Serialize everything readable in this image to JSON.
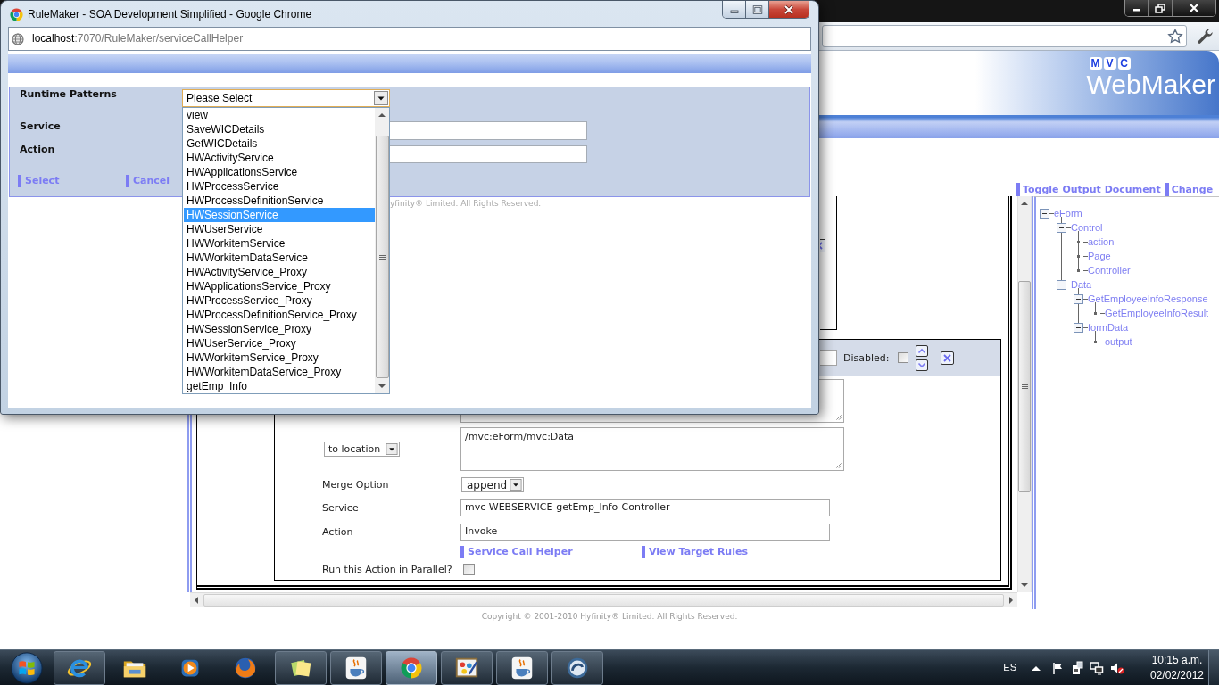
{
  "popup_window": {
    "title": "RuleMaker - SOA Development Simplified - Google Chrome",
    "address": {
      "host": "localhost",
      "path": ":7070/RuleMaker/serviceCallHelper"
    },
    "form": {
      "runtime_patterns": {
        "label": "Runtime Patterns",
        "value": "Please Select",
        "expanded": true,
        "options": [
          {
            "label": "view",
            "selected": false
          },
          {
            "label": "SaveWICDetails",
            "selected": false
          },
          {
            "label": "GetWICDetails",
            "selected": false
          },
          {
            "label": "HWActivityService",
            "selected": false
          },
          {
            "label": "HWApplicationsService",
            "selected": false
          },
          {
            "label": "HWProcessService",
            "selected": false
          },
          {
            "label": "HWProcessDefinitionService",
            "selected": false
          },
          {
            "label": "HWSessionService",
            "selected": true
          },
          {
            "label": "HWUserService",
            "selected": false
          },
          {
            "label": "HWWorkitemService",
            "selected": false
          },
          {
            "label": "HWWorkitemDataService",
            "selected": false
          },
          {
            "label": "HWActivityService_Proxy",
            "selected": false
          },
          {
            "label": "HWApplicationsService_Proxy",
            "selected": false
          },
          {
            "label": "HWProcessService_Proxy",
            "selected": false
          },
          {
            "label": "HWProcessDefinitionService_Proxy",
            "selected": false
          },
          {
            "label": "HWSessionService_Proxy",
            "selected": false
          },
          {
            "label": "HWUserService_Proxy",
            "selected": false
          },
          {
            "label": "HWWorkitemService_Proxy",
            "selected": false
          },
          {
            "label": "HWWorkitemDataService_Proxy",
            "selected": false
          },
          {
            "label": "getEmp_Info",
            "selected": false
          }
        ]
      },
      "service": {
        "label": "Service"
      },
      "action": {
        "label": "Action"
      },
      "links": [
        "Select",
        "Cancel"
      ]
    },
    "footer": "yfinity® Limited. All Rights Reserved."
  },
  "browser_page": {
    "logo": {
      "letters": [
        "M",
        "V",
        "C"
      ],
      "name": "WebMaker"
    },
    "output_links": [
      "Toggle Output Document",
      "Change"
    ],
    "rule_row": {
      "disabled": {
        "label": "Disabled:",
        "checked": false
      }
    },
    "action_form": {
      "location": {
        "option": "to location",
        "value": "/mvc:eForm/mvc:Data"
      },
      "merge_option": {
        "label": "Merge Option",
        "value": "append"
      },
      "service": {
        "label": "Service",
        "value": "mvc-WEBSERVICE-getEmp_Info-Controller"
      },
      "action": {
        "label": "Action",
        "value": "Invoke"
      },
      "links": [
        "Service Call Helper",
        "View Target Rules"
      ],
      "parallel": {
        "label": "Run this Action in Parallel?",
        "checked": false
      }
    },
    "output_tree": [
      {
        "label": "eForm",
        "expanded": true,
        "children": [
          {
            "label": "Control",
            "expanded": true,
            "children": [
              {
                "label": "action"
              },
              {
                "label": "Page"
              },
              {
                "label": "Controller"
              }
            ]
          },
          {
            "label": "Data",
            "expanded": true,
            "children": [
              {
                "label": "GetEmployeeInfoResponse",
                "expanded": true,
                "children": [
                  {
                    "label": "GetEmployeeInfoResult"
                  }
                ]
              },
              {
                "label": "formData",
                "expanded": true,
                "children": [
                  {
                    "label": "output"
                  }
                ]
              }
            ]
          }
        ]
      }
    ],
    "footer": "Copyright © 2001-2010 Hyfinity® Limited. All Rights Reserved."
  },
  "taskbar": {
    "apps": [
      {
        "kind": "ebrowser",
        "running": true,
        "selected": false
      },
      {
        "kind": "folder",
        "running": false,
        "selected": false
      },
      {
        "kind": "player",
        "running": false,
        "selected": false
      },
      {
        "kind": "foxbrowser",
        "running": false,
        "selected": false
      },
      {
        "kind": "notes",
        "running": true,
        "selected": false
      },
      {
        "kind": "cup",
        "running": true,
        "selected": false
      },
      {
        "kind": "roundbrowser",
        "running": true,
        "selected": true
      },
      {
        "kind": "picture",
        "running": true,
        "selected": false
      },
      {
        "kind": "cup",
        "running": true,
        "selected": false
      },
      {
        "kind": "swirl",
        "running": true,
        "selected": false
      }
    ],
    "language": "ES",
    "time": "10:15 a.m.",
    "date": "02/02/2012"
  }
}
